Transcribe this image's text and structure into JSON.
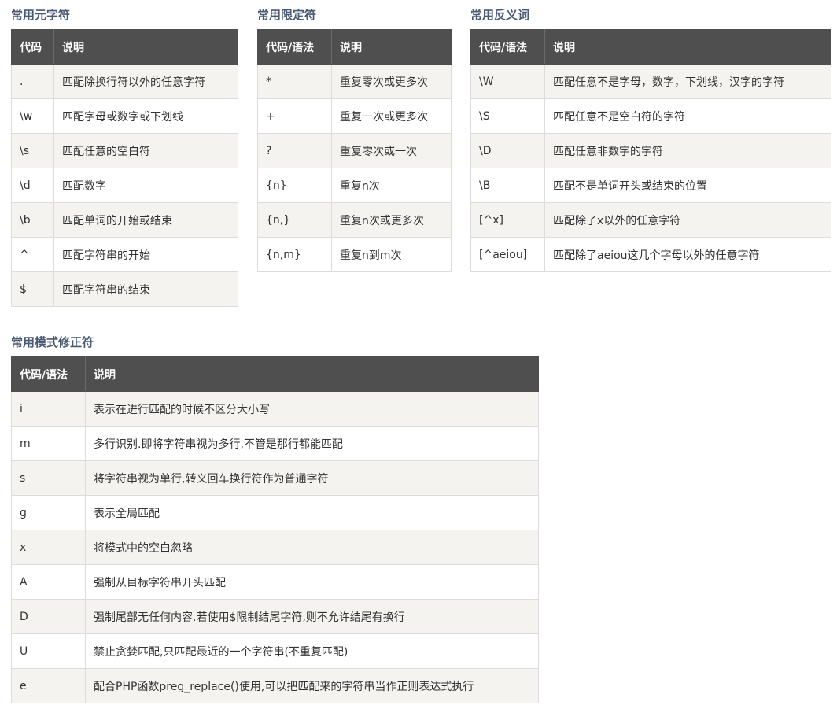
{
  "meta_chars": {
    "title": "常用元字符",
    "header": [
      "代码",
      "说明"
    ],
    "rows": [
      [
        ".",
        "匹配除换行符以外的任意字符"
      ],
      [
        "\\w",
        "匹配字母或数字或下划线"
      ],
      [
        "\\s",
        "匹配任意的空白符"
      ],
      [
        "\\d",
        "匹配数字"
      ],
      [
        "\\b",
        "匹配单词的开始或结束"
      ],
      [
        "^",
        "匹配字符串的开始"
      ],
      [
        "$",
        "匹配字符串的结束"
      ]
    ]
  },
  "quantifiers": {
    "title": "常用限定符",
    "header": [
      "代码/语法",
      "说明"
    ],
    "rows": [
      [
        "*",
        "重复零次或更多次"
      ],
      [
        "+",
        "重复一次或更多次"
      ],
      [
        "?",
        "重复零次或一次"
      ],
      [
        "{n}",
        "重复n次"
      ],
      [
        "{n,}",
        "重复n次或更多次"
      ],
      [
        "{n,m}",
        "重复n到m次"
      ]
    ]
  },
  "negations": {
    "title": "常用反义词",
    "header": [
      "代码/语法",
      "说明"
    ],
    "rows": [
      [
        "\\W",
        "匹配任意不是字母，数字，下划线，汉字的字符"
      ],
      [
        "\\S",
        "匹配任意不是空白符的字符"
      ],
      [
        "\\D",
        "匹配任意非数字的字符"
      ],
      [
        "\\B",
        "匹配不是单词开头或结束的位置"
      ],
      [
        "[^x]",
        "匹配除了x以外的任意字符"
      ],
      [
        "[^aeiou]",
        "匹配除了aeiou这几个字母以外的任意字符"
      ]
    ]
  },
  "modifiers": {
    "title": "常用模式修正符",
    "header": [
      "代码/语法",
      "说明"
    ],
    "rows": [
      [
        "i",
        "表示在进行匹配的时候不区分大小写"
      ],
      [
        "m",
        "多行识别.即将字符串视为多行,不管是那行都能匹配"
      ],
      [
        "s",
        "将字符串视为单行,转义回车换行符作为普通字符"
      ],
      [
        "g",
        "表示全局匹配"
      ],
      [
        "x",
        "将模式中的空白忽略"
      ],
      [
        "A",
        "强制从目标字符串开头匹配"
      ],
      [
        "D",
        "强制尾部无任何内容.若使用$限制结尾字符,则不允许结尾有换行"
      ],
      [
        "U",
        "禁止贪婪匹配,只匹配最近的一个字符串(不重复匹配)"
      ],
      [
        "e",
        "配合PHP函数preg_replace()使用,可以把匹配来的字符串当作正则表达式执行"
      ]
    ]
  }
}
